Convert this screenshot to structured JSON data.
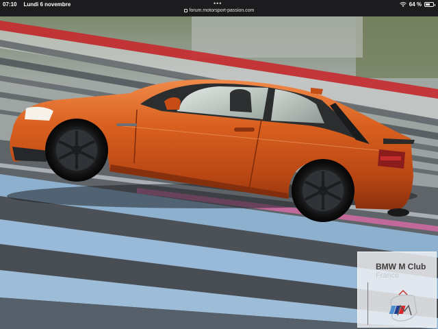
{
  "status_bar": {
    "time": "07:10",
    "date": "Lundi 6 novembre",
    "url": "forum.motorsport-passion.com",
    "battery_percent_label": "64 %",
    "battery_level": 0.64,
    "icons": [
      "lock-icon",
      "wifi-icon",
      "battery-icon",
      "more-dots-icon"
    ]
  },
  "photo": {
    "watermark": {
      "title": "BMW M Club",
      "subtitle": "France"
    },
    "colors": {
      "car_body": "#d65a1e",
      "track_blue": "#8fb3d3",
      "curb_red": "#c8282b"
    }
  }
}
